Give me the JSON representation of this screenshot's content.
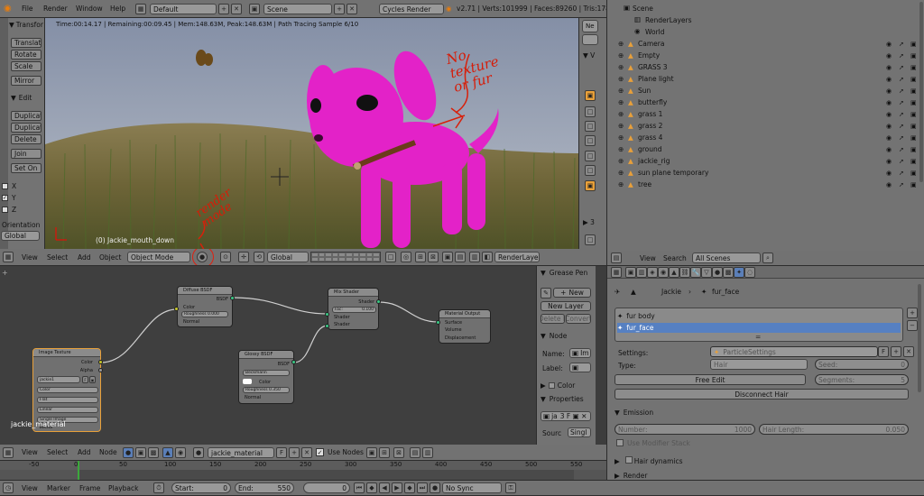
{
  "info_bar": {
    "menu_file": "File",
    "menu_render": "Render",
    "menu_window": "Window",
    "menu_help": "Help",
    "layout": "Default",
    "scene": "Scene",
    "engine": "Cycles Render",
    "stats": "v2.71 | Verts:101999 | Faces:89260 | Tris:178"
  },
  "viewport": {
    "render_stats": "Time:00:14.17 | Remaining:00:09.45 | Mem:148.63M, Peak:148.63M | Path Tracing Sample 6/10",
    "object_label": "(0) Jackie_mouth_down",
    "annotation_1": "No texture or fur",
    "annotation_2": "render mode"
  },
  "tool_shelf": {
    "transform": "Transfor",
    "translate": "Translat",
    "rotate": "Rotate",
    "scale": "Scale",
    "mirror": "Mirror",
    "edit": "Edit",
    "duplicate": "Duplicat",
    "duplicate_linked": "Duplicat",
    "delete": "Delete",
    "join": "Join",
    "set_origin": "Set On",
    "x": "X",
    "y": "Y",
    "z": "Z",
    "orientation_label": "Orientation",
    "orientation_value": "Global"
  },
  "viewport_header": {
    "view": "View",
    "select": "Select",
    "add": "Add",
    "object": "Object",
    "mode": "Object Mode",
    "orientation": "Global",
    "render_layer": "RenderLayer"
  },
  "outliner": {
    "root": "Scene",
    "render_layers": "RenderLayers",
    "world": "World",
    "items": [
      {
        "name": "Camera"
      },
      {
        "name": "Empty"
      },
      {
        "name": "GRASS 3"
      },
      {
        "name": "Plane light"
      },
      {
        "name": "Sun"
      },
      {
        "name": "butterfly"
      },
      {
        "name": "grass 1"
      },
      {
        "name": "grass 2"
      },
      {
        "name": "grass 4"
      },
      {
        "name": "ground"
      },
      {
        "name": "jackie_rig"
      },
      {
        "name": "sun plane temporary"
      },
      {
        "name": "tree"
      }
    ]
  },
  "props_header": {
    "view": "View",
    "search": "Search",
    "filter": "All Scenes"
  },
  "properties": {
    "breadcrumb_object": "Jackie",
    "breadcrumb_system": "fur_face",
    "systems": [
      "fur body",
      "fur_face"
    ],
    "settings_label": "Settings:",
    "settings_value": "ParticleSettings",
    "settings_users": "F",
    "type_label": "Type:",
    "type_value": "Hair",
    "seed_label": "Seed:",
    "seed_value": "0",
    "free_edit": "Free Edit",
    "segments_label": "Segments:",
    "segments_value": "5",
    "disconnect": "Disconnect Hair",
    "emission": "Emission",
    "number_label": "Number:",
    "number_value": "1000",
    "hair_length_label": "Hair Length:",
    "hair_length_value": "0.050",
    "use_modifier_stack": "Use Modifier Stack",
    "hair_dynamics": "Hair dynamics",
    "render": "Render"
  },
  "node_editor": {
    "material_label": "jackie_material",
    "nodes": {
      "diffuse": {
        "title": "Diffuse BSDF",
        "out": "BSDF",
        "color": "Color",
        "roughness": "Roughness 0.000",
        "normal": "Normal"
      },
      "mix": {
        "title": "Mix Shader",
        "out": "Shader",
        "fac": "Fac:",
        "fac_value": "0.100",
        "shader1": "Shader",
        "shader2": "Shader"
      },
      "output": {
        "title": "Material Output",
        "surface": "Surface",
        "volume": "Volume",
        "displacement": "Displacement"
      },
      "glossy": {
        "title": "Glossy BSDF",
        "out": "BSDF",
        "dist": "Beckmann",
        "color": "Color",
        "roughness": "Roughness 0.350",
        "normal": "Normal"
      },
      "image": {
        "title": "Image Texture",
        "color": "Color",
        "alpha": "Alpha",
        "image": "jackie1",
        "opt1": "Color",
        "opt2": "Flat",
        "opt3": "Linear",
        "opt4": "Single Image",
        "vector": "Vector"
      }
    }
  },
  "node_sidebar": {
    "grease_pencil": "Grease Pen",
    "new": "New",
    "new_layer": "New Layer",
    "delete": "Delete F",
    "convert": "Convert",
    "node": "Node",
    "name_label": "Name:",
    "name_value": "Im",
    "label_label": "Label:",
    "color": "Color",
    "properties": "Properties",
    "source_label": "Sourc",
    "source_value": "Singl",
    "image_short": "ja"
  },
  "node_header": {
    "view": "View",
    "select": "Select",
    "add": "Add",
    "node": "Node",
    "material": "jackie_material",
    "users": "F",
    "use_nodes": "Use Nodes"
  },
  "timeline": {
    "ticks": [
      "-50",
      "0",
      "50",
      "100",
      "150",
      "200",
      "250",
      "300",
      "350",
      "400",
      "450",
      "500",
      "550"
    ]
  },
  "timeline_header": {
    "view": "View",
    "marker": "Marker",
    "frame": "Frame",
    "playback": "Playback",
    "start_label": "Start:",
    "start_value": "0",
    "end_label": "End:",
    "end_value": "550",
    "current": "0",
    "sync": "No Sync"
  }
}
